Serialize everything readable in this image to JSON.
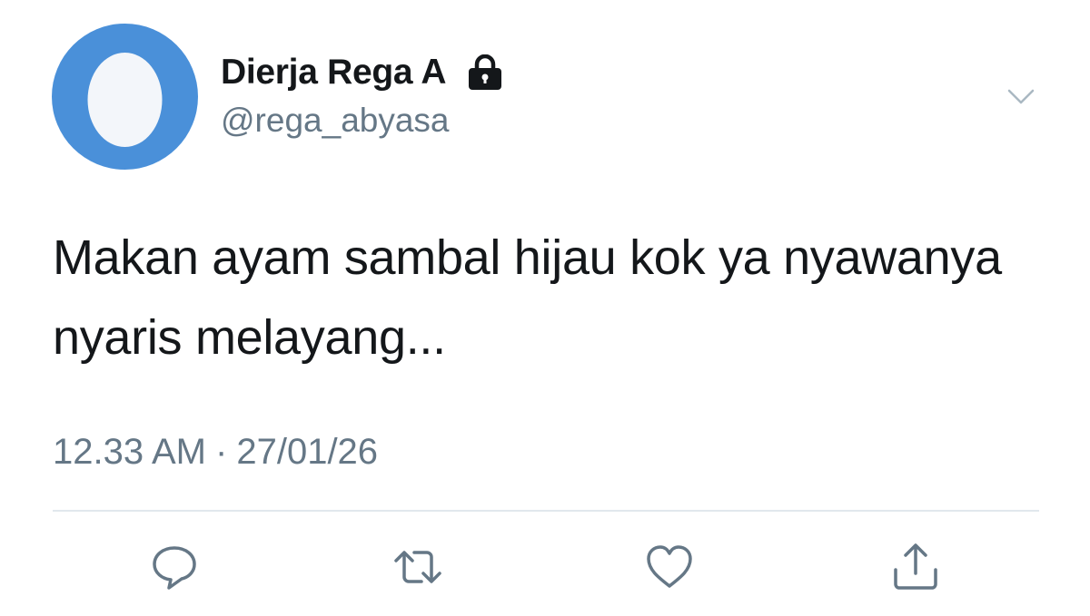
{
  "tweet": {
    "display_name": "Dierja Rega A",
    "handle": "@rega_abyasa",
    "text": "Makan ayam sambal hijau kok ya nyawanya nyaris melayang...",
    "time": "12.33 AM",
    "separator": "·",
    "date": "27/01/26",
    "protected": true
  },
  "icons": {
    "avatar": "default-egg-avatar",
    "protected": "lock-icon",
    "menu": "chevron-down-icon",
    "actions": [
      "reply-icon",
      "retweet-icon",
      "like-icon",
      "share-icon"
    ]
  },
  "colors": {
    "avatar_bg": "#4a90d9",
    "egg": "#f3f6fa",
    "text": "#14171a",
    "secondary": "#657786",
    "divider": "#e1e8ed"
  }
}
